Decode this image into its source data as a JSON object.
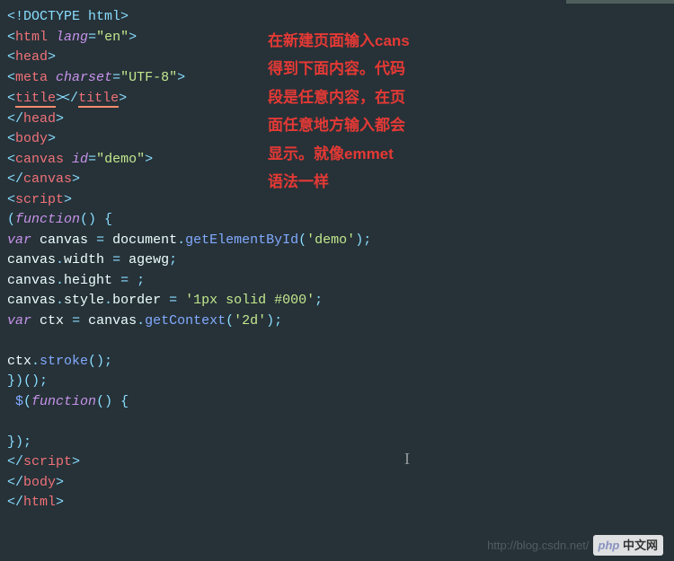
{
  "code": {
    "l1": "<!DOCTYPE html>",
    "l2": {
      "tag": "html",
      "attr": "lang",
      "val": "\"en\""
    },
    "l3": {
      "tag": "head"
    },
    "l4": {
      "tag": "meta",
      "attr": "charset",
      "val": "\"UTF-8\""
    },
    "l5": {
      "tag": "title"
    },
    "l6": {
      "tag": "head"
    },
    "l7": {
      "tag": "body"
    },
    "l8": {
      "tag": "canvas",
      "attr": "id",
      "val": "\"demo\""
    },
    "l9": {
      "tag": "canvas"
    },
    "l10": {
      "tag": "script"
    },
    "l11": {
      "kw": "function",
      "pre": "(",
      "post": "() {"
    },
    "l12": {
      "kw": "var",
      "v": "canvas",
      "op": "=",
      "obj": "document",
      "m": "getElementById",
      "arg": "'demo'",
      "end": ");"
    },
    "l13": {
      "v": "canvas",
      "prop": "width",
      "op": "=",
      "rhs": "agewg",
      "end": ";"
    },
    "l14": {
      "v": "canvas",
      "prop": "height",
      "op": "=",
      "rhs": "",
      "end": ";"
    },
    "l15": {
      "v": "canvas",
      "p1": "style",
      "p2": "border",
      "op": "=",
      "rhs": "'1px solid #000'",
      "end": ";"
    },
    "l16": {
      "kw": "var",
      "v": "ctx",
      "op": "=",
      "obj": "canvas",
      "m": "getContext",
      "arg": "'2d'",
      "end": ");"
    },
    "l17": "",
    "l18": {
      "v": "ctx",
      "m": "stroke",
      "end": "();"
    },
    "l19": "})();",
    "l20": {
      "d": "$",
      "kw": "function",
      "pre": "(",
      "post": "() {"
    },
    "l21": "",
    "l22": "});",
    "l23": {
      "tag": "script"
    },
    "l24": {
      "tag": "body"
    },
    "l25": {
      "tag": "html"
    }
  },
  "annotation": {
    "l1": "在新建页面输入cans",
    "l2": "得到下面内容。代码",
    "l3": "段是任意内容，在页",
    "l4": "面任意地方输入都会",
    "l5": "显示。就像emmet",
    "l6": "语法一样"
  },
  "watermark": {
    "url": "http://blog.csdn.net/",
    "php": "php",
    "site": "中文网"
  }
}
